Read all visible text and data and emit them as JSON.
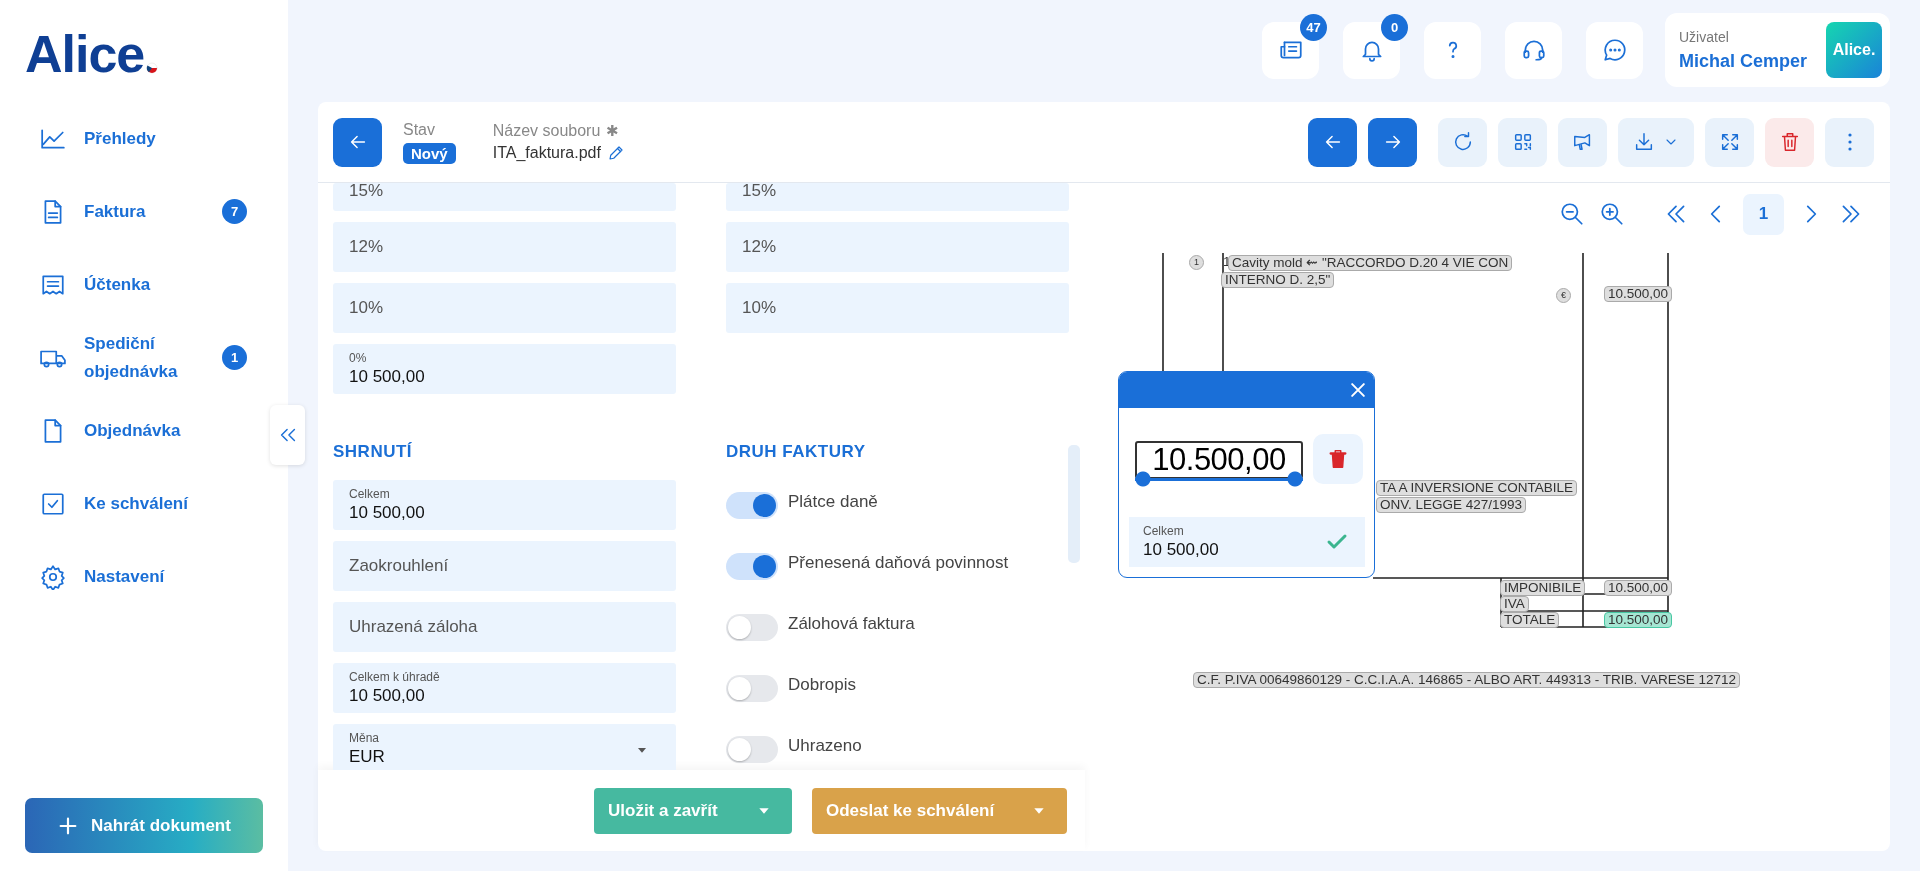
{
  "sidebar": {
    "logo": "Alice",
    "nav": [
      {
        "label": "Přehledy"
      },
      {
        "label": "Faktura",
        "badge": "7"
      },
      {
        "label": "Účtenka"
      },
      {
        "label": "Spediční objednávka",
        "badge": "1"
      },
      {
        "label": "Objednávka"
      },
      {
        "label": "Ke schválení"
      },
      {
        "label": "Nastavení"
      }
    ],
    "upload_button": "Nahrát dokument"
  },
  "header": {
    "badges": [
      "47",
      "0"
    ],
    "user": {
      "label": "Uživatel",
      "name": "Michal Cemper",
      "logo": "Alice."
    }
  },
  "document_bar": {
    "status_label": "Stav",
    "status": "Nový",
    "filename_label": "Název souboru",
    "required_mark": "✱",
    "filename": "ITA_faktura.pdf"
  },
  "form": {
    "vat_left": [
      {
        "label": "15%"
      },
      {
        "label": "12%"
      },
      {
        "label": "10%"
      },
      {
        "label": "0%",
        "value": "10 500,00"
      }
    ],
    "vat_right": [
      {
        "label": "15%"
      },
      {
        "label": "12%"
      },
      {
        "label": "10%"
      }
    ],
    "summary": {
      "title": "SHRNUTÍ",
      "fields": [
        {
          "kind": "text",
          "label": "Celkem",
          "value": "10 500,00"
        },
        {
          "kind": "text",
          "label": "Zaokrouhlení"
        },
        {
          "kind": "text",
          "label": "Uhrazená záloha"
        },
        {
          "kind": "text",
          "label": "Celkem k úhradě",
          "value": "10 500,00"
        },
        {
          "kind": "select",
          "label": "Měna",
          "value": "EUR"
        }
      ]
    },
    "invoice_type": {
      "title": "DRUH FAKTURY",
      "toggles": [
        {
          "label": "Plátce daně",
          "on": true
        },
        {
          "label": "Přenesená daňová povinnost",
          "on": true
        },
        {
          "label": "Zálohová faktura",
          "on": false
        },
        {
          "label": "Dobropis",
          "on": false
        },
        {
          "label": "Uhrazeno",
          "on": false
        }
      ]
    }
  },
  "footer_buttons": [
    {
      "label": "Uložit a zavřít",
      "color": "#46b9a0"
    },
    {
      "label": "Odeslat ke schválení",
      "color": "#d9a24a"
    }
  ],
  "viewer": {
    "page": "1",
    "document_texts": [
      {
        "kind": "circled",
        "text": "1"
      },
      {
        "kind": "plain",
        "text": "1"
      },
      {
        "kind": "box",
        "text": "Cavity  mold ⇜ \"RACCORDO D.20 4 VIE CON"
      },
      {
        "kind": "box",
        "text": "INTERNO D. 2,5\""
      },
      {
        "kind": "circled",
        "text": "€"
      },
      {
        "kind": "box",
        "text": "10.500,00"
      },
      {
        "kind": "box",
        "text": "TA A INVERSIONE CONTABILE"
      },
      {
        "kind": "box",
        "text": "ONV. LEGGE 427/1993"
      },
      {
        "kind": "box",
        "text": "IMPONIBILE"
      },
      {
        "kind": "box",
        "text": "10.500,00"
      },
      {
        "kind": "box",
        "text": "IVA"
      },
      {
        "kind": "box",
        "text": "TOTALE"
      },
      {
        "kind": "highlight",
        "text": "10.500,00"
      },
      {
        "kind": "box",
        "text": "C.F. P.IVA 00649860129 - C.C.I.A.A. 146865 - ALBO ART. 449313 - TRIB. VARESE 12712"
      }
    ],
    "popup": {
      "snippet": "10.500,00",
      "field_label": "Celkem",
      "field_value": "10 500,00"
    }
  }
}
